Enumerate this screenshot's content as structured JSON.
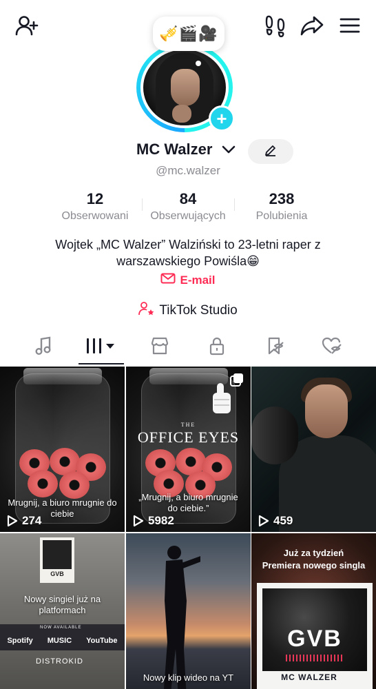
{
  "header": {
    "emoji_bubble": "🎺🎬🎥"
  },
  "profile": {
    "display_name": "MC Walzer",
    "username": "@mc.walzer",
    "stats": [
      {
        "value": "12",
        "label": "Obserwowani"
      },
      {
        "value": "84",
        "label": "Obserwujących"
      },
      {
        "value": "238",
        "label": "Polubienia"
      }
    ],
    "bio_line1": "Wojtek „MC Walzer” Walziński to 23-letni raper z",
    "bio_line2": "warszawskiego Powiśla😁",
    "email_label": "E-mail",
    "studio_label": "TikTok Studio"
  },
  "tabs": [
    "music-tab",
    "videos-tab",
    "shop-tab",
    "private-tab",
    "saved-tab",
    "liked-tab"
  ],
  "videos": [
    {
      "caption": "Mrugnij, a biuro mrugnie do ciebie",
      "views": "274"
    },
    {
      "title_small": "THE",
      "title": "OFFICE EYES",
      "caption": "„Mrugnij, a biuro mrugnie do ciebie.”",
      "views": "5982"
    },
    {
      "views": "459"
    },
    {
      "caption": "Nowy singiel już na platformach",
      "now_available": "NOW AVAILABLE",
      "logos": [
        "Spotify",
        "MUSIC",
        "YouTube"
      ],
      "distributor": "DISTROKID",
      "poster_text": "GVB"
    },
    {
      "caption": "Nowy klip wideo na YT"
    },
    {
      "premiere_line1": "Już za tydzień",
      "premiere_line2": "Premiera nowego singla",
      "cover_title": "GVB",
      "cover_artist": "MC WALZER"
    }
  ],
  "colors": {
    "accent": "#fe2c55",
    "avatar_ring": "#25f4ee",
    "add_badge": "#20d5ec",
    "text": "#161823",
    "muted": "#8a8b91"
  }
}
